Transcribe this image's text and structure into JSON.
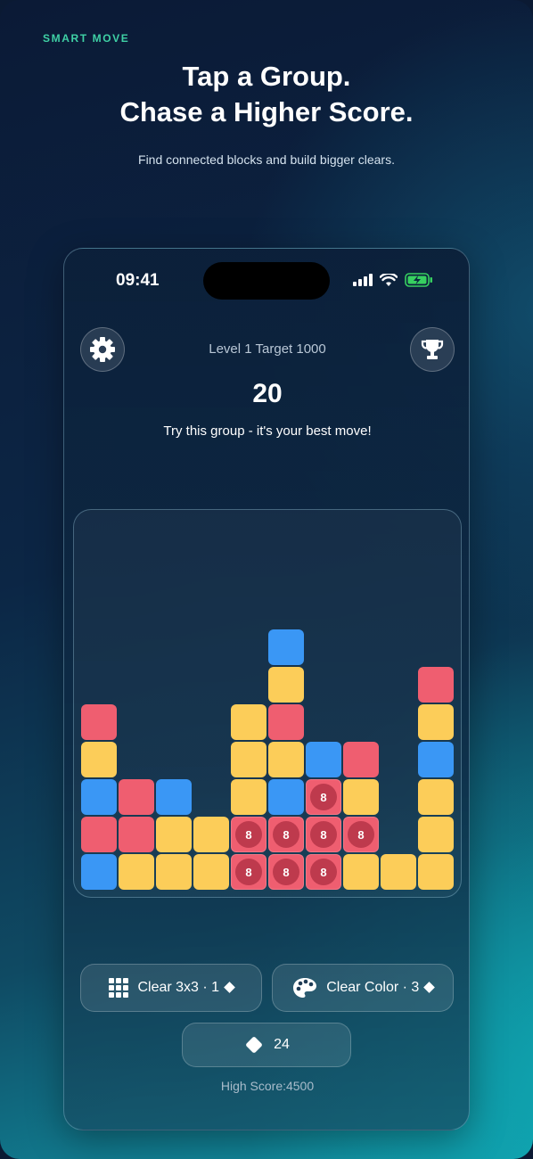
{
  "promo": {
    "eyebrow": "SMART MOVE",
    "headline_line1": "Tap a Group.",
    "headline_line2": "Chase a Higher Score.",
    "subtitle": "Find connected blocks and build bigger clears."
  },
  "status_bar": {
    "time": "09:41",
    "icons": [
      "signal-icon",
      "wifi-icon",
      "battery-charging-icon"
    ]
  },
  "game": {
    "level_label": "Level 1 Target 1000",
    "score": "20",
    "hint": "Try this group - it's your best move!",
    "colors": {
      "red": "#ef5e70",
      "yellow": "#fccd59",
      "blue": "#3a97f5"
    },
    "highlight_count_label": "8",
    "board_columns": [
      {
        "col": 0,
        "tiles_bottom_to_top": [
          "blue",
          "red",
          "blue",
          "yellow",
          "red"
        ]
      },
      {
        "col": 1,
        "tiles_bottom_to_top": [
          "yellow",
          "red",
          "red"
        ]
      },
      {
        "col": 2,
        "tiles_bottom_to_top": [
          "yellow",
          "yellow",
          "blue"
        ]
      },
      {
        "col": 3,
        "tiles_bottom_to_top": [
          "yellow",
          "yellow"
        ]
      },
      {
        "col": 4,
        "tiles_bottom_to_top": [
          "red*",
          "red*",
          "yellow",
          "yellow",
          "yellow"
        ]
      },
      {
        "col": 5,
        "tiles_bottom_to_top": [
          "red*",
          "red*",
          "blue",
          "yellow",
          "red",
          "yellow",
          "blue"
        ]
      },
      {
        "col": 6,
        "tiles_bottom_to_top": [
          "red*",
          "red*",
          "red*",
          "blue"
        ]
      },
      {
        "col": 7,
        "tiles_bottom_to_top": [
          "yellow",
          "red*",
          "yellow",
          "red"
        ]
      },
      {
        "col": 8,
        "tiles_bottom_to_top": [
          "yellow"
        ]
      },
      {
        "col": 9,
        "tiles_bottom_to_top": [
          "yellow",
          "yellow",
          "yellow",
          "blue",
          "yellow",
          "red"
        ]
      }
    ]
  },
  "powerups": {
    "clear3x3": {
      "label": "Clear 3x3 · 1",
      "icon": "grid-icon"
    },
    "clear_color": {
      "label": "Clear Color · 3",
      "icon": "palette-icon"
    }
  },
  "gems": {
    "count": "24",
    "icon": "diamond-icon"
  },
  "high_score_label": "High Score:4500"
}
